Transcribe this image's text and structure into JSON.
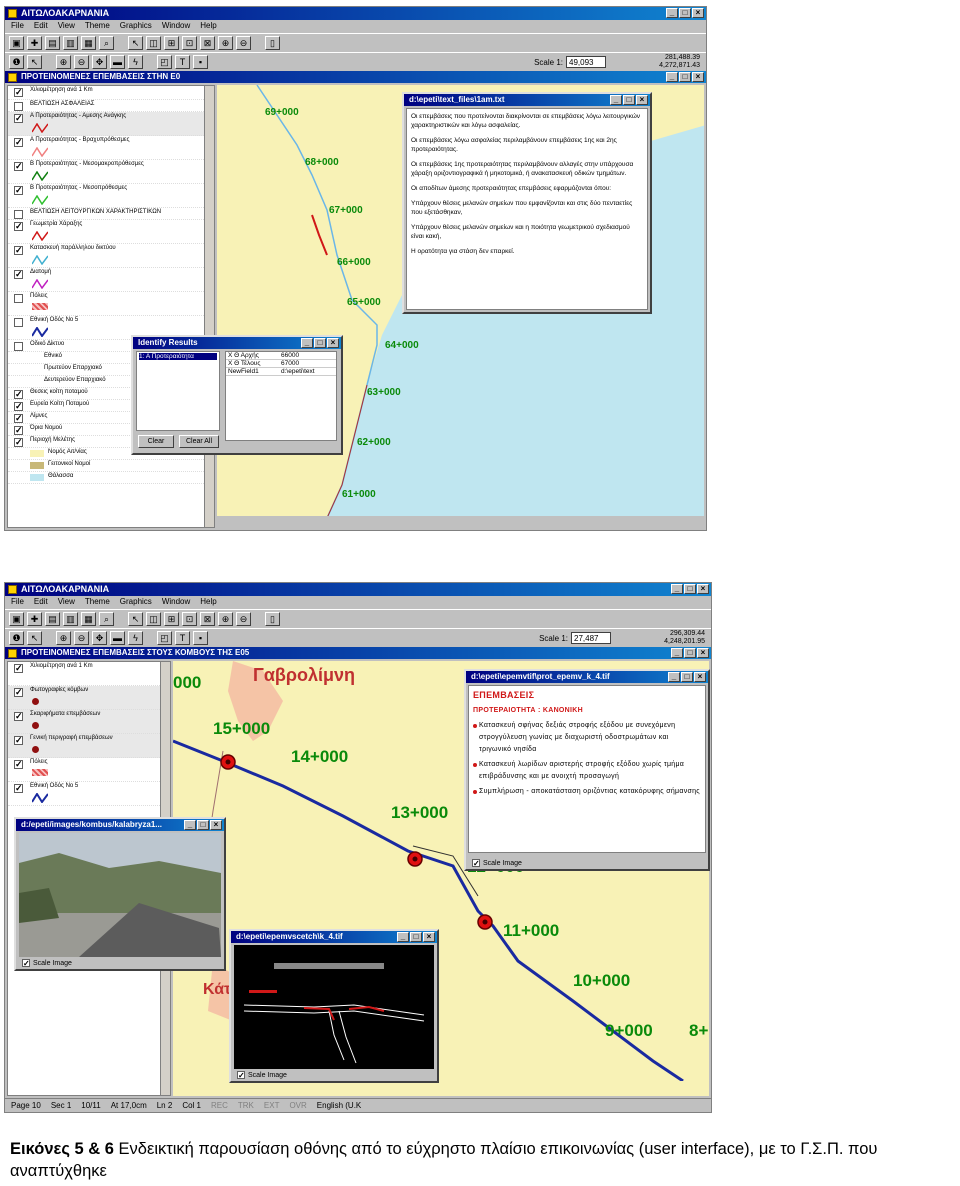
{
  "shot1": {
    "app_title": "ΑΙΤΩΛΟΑΚΑΡΝΑΝΙΑ",
    "menu": [
      "File",
      "Edit",
      "View",
      "Theme",
      "Graphics",
      "Window",
      "Help"
    ],
    "scale_label": "Scale 1:",
    "scale_value": "49,093",
    "coords": [
      "281,488.39",
      "4,272,871.43"
    ],
    "view_title": "ΠΡΟΤΕΙΝΟΜΕΝΕΣ ΕΠΕΜΒΑΣΕΙΣ ΣΤΗΝ Ε0",
    "legend": [
      {
        "label": "Χιλιομέτρηση ανά 1 Km",
        "checked": true
      },
      {
        "label": "ΒΕΛΤΙΩΣΗ ΑΣΦΑΛΕΙΑΣ",
        "checked": false
      },
      {
        "label": "Α Προτεραιότητας - Αμεσης Ανάγκης",
        "checked": true
      },
      {
        "label": "Α Προτεραιότητας - Βραχυπρόθεσμες",
        "checked": true
      },
      {
        "label": "Β Προτεραιότητας - Μεσομακροπρόθεσμες",
        "checked": true
      },
      {
        "label": "Β Προτεραιότητας - Μεσοπρόθεσμες",
        "checked": true
      },
      {
        "label": "ΒΕΛΤΙΩΣΗ ΛΕΙΤΟΥΡΓΙΚΩΝ ΧΑΡΑΚΤΗΡΙΣΤΙΚΩΝ",
        "checked": false
      },
      {
        "label": "Γεωμετρία Χάραξης",
        "checked": true
      },
      {
        "label": "Κατασκευή παράλληλου δικτύου",
        "checked": true
      },
      {
        "label": "Διατομή",
        "checked": true
      },
      {
        "label": "Πόλεις",
        "checked": false
      },
      {
        "label": "Εθνική Οδός Νο 5",
        "checked": false
      },
      {
        "label": "Οδικό Δίκτυο",
        "checked": false
      },
      {
        "label": "Εθνικό",
        "checked": false
      },
      {
        "label": "Πρωτεύον Επαρχιακό",
        "checked": false
      },
      {
        "label": "Δευτερεύον Επαρχιακό",
        "checked": false
      },
      {
        "label": "Θεσεις κοίτη ποταμού",
        "checked": true
      },
      {
        "label": "Ευρεία Κοίτη Ποταμού",
        "checked": true
      },
      {
        "label": "Λίμνες",
        "checked": true
      },
      {
        "label": "Όρια Νομού",
        "checked": true
      },
      {
        "label": "Περιοχή Μελέτης",
        "checked": true
      },
      {
        "label": "Νομός Αιτ/νίας",
        "checked": false
      },
      {
        "label": "Γειτονικοί Νομοί",
        "checked": false
      },
      {
        "label": "Θάλασσα",
        "checked": false
      }
    ],
    "km_labels": [
      "69+000",
      "68+000",
      "67+000",
      "66+000",
      "65+000",
      "64+000",
      "63+000",
      "62+000",
      "61+000"
    ],
    "text_window": {
      "title": "d:\\epeti\\text_files\\1am.txt",
      "paragraphs": [
        "Οι επεμβάσεις που προτείνονται διακρίνονται σε επεμβάσεις λόγω λειτουργικών χαρακτηριστικών και λόγω ασφαλείας.",
        "Οι επεμβάσεις λόγω ασφαλείας περιλαμβάνουν επεμβάσεις 1ης και 2ης προτεραιότητας.",
        "Οι επεμβάσεις 1ης προτεραιότητας περιλαμβάνουν αλλαγές στην υπάρχουσα χάραξη οριζοντιογραφικά ή μηκοτομικά, ή ανακατασκευή οδικών τμημάτων.",
        "Οι αποδίτων άμεσης προτεραιότητας επεμβάσεις εφαρμόζονται όπου:",
        "Υπάρχουν θέσεις μελανών σημείων που εμφανίζονται και στις δύο πενταετίες που εξετάσθηκαν,",
        "Υπάρχουν θέσεις μελανών σημείων και η ποιότητα γεωμετρικού σχεδιασμού είναι κακή,",
        "Η ορατότητα για στάση δεν επαρκεί."
      ]
    },
    "identify_window": {
      "title": "Identify Results",
      "list_item": "1: Α Προτεραιότητα",
      "rows": [
        [
          "Χ Θ Αρχής",
          "66000"
        ],
        [
          "Χ Θ Τέλους",
          "67000"
        ],
        [
          "NewField1",
          "d:\\epeti\\text"
        ]
      ],
      "clear_label": "Clear",
      "clear_all_label": "Clear All"
    }
  },
  "shot2": {
    "app_title": "ΑΙΤΩΛΟΑΚΑΡΝΑΝΙΑ",
    "menu": [
      "File",
      "Edit",
      "View",
      "Theme",
      "Graphics",
      "Window",
      "Help"
    ],
    "scale_label": "Scale 1:",
    "scale_value": "27,487",
    "coords": [
      "296,309.44",
      "4,248,201.95"
    ],
    "view_title": "ΠΡΟΤΕΙΝΟΜΕΝΕΣ ΕΠΕΜΒΑΣΕΙΣ ΣΤΟΥΣ ΚΟΜΒΟΥΣ ΤΗΣ Ε05",
    "legend": [
      {
        "label": "Χιλιομέτρηση ανά 1 Km",
        "checked": true
      },
      {
        "label": "Φωτογραφίες κόμβων",
        "checked": true
      },
      {
        "label": "Σκαριφήματα επεμβάσεων",
        "checked": true
      },
      {
        "label": "Γενική περιγραφή επεμβάσεων",
        "checked": true
      },
      {
        "label": "Πόλεις",
        "checked": true
      },
      {
        "label": "Εθνική Οδός Νο 5",
        "checked": true
      }
    ],
    "place_labels": [
      "Γαβρολίμνη",
      "Κάτ"
    ],
    "km_labels": [
      "000",
      "15+000",
      "14+000",
      "13+000",
      "12+000",
      "11+000",
      "10+000",
      "9+000",
      "8+("
    ],
    "text_window": {
      "title": "d:\\epeti\\epemvtif\\prot_epemv_k_4.tif",
      "heading": "ΕΠΕΜΒΑΣΕΙΣ",
      "subheading": "ΠΡΟΤΕΡΑΙΟΤΗΤΑ : ΚΑΝΟΝΙΚΗ",
      "bullets": [
        "Κατασκευή σφήνας δεξιάς στροφής εξόδου με συνεχόμενη στρογγύλευση γωνίας με διαχωριστή οδοστρωμάτων και τριγωνικό νησίδα",
        "Κατασκευή λωρίδων αριστερής στροφής εξόδου χωρίς τμήμα επιβράδυνσης και με ανοιχτή προσαγωγή",
        "Συμπλήρωση - αποκατάσταση οριζόντιας κατακόρυφης σήμανσης"
      ],
      "scale_image_label": "Scale Image"
    },
    "photo_window": {
      "title": "d:/epeti/images/kombus/kalabryza1...",
      "scale_image_label": "Scale Image"
    },
    "sketch_window": {
      "title": "d:\\epeti\\epemvscetch\\k_4.tif",
      "scale_image_label": "Scale Image"
    },
    "status": [
      "Page 10",
      "Sec 1",
      "10/11",
      "At 17,0cm",
      "Ln 2",
      "Col 1",
      "REC",
      "TRK",
      "EXT",
      "OVR",
      "English (U.K"
    ]
  },
  "caption": {
    "bold": "Εικόνες 5 & 6",
    "text": " Ενδεικτική παρουσίαση οθόνης από το εύχρηστο πλαίσιο επικοινωνίας (user interface), με το Γ.Σ.Π. που αναπτύχθηκε"
  },
  "colors": {
    "titlebar": "#000080",
    "map_land": "#f8f2b6",
    "km_green": "#0a8a0a",
    "road_blue": "#1a2aa0",
    "intervention_red": "#d01818"
  },
  "icons": [
    "app-icon",
    "save-icon",
    "open-icon",
    "print-icon",
    "zoom-in-icon",
    "zoom-out-icon",
    "pointer-icon",
    "identify-icon",
    "text-tool-icon",
    "hotlink-icon"
  ]
}
